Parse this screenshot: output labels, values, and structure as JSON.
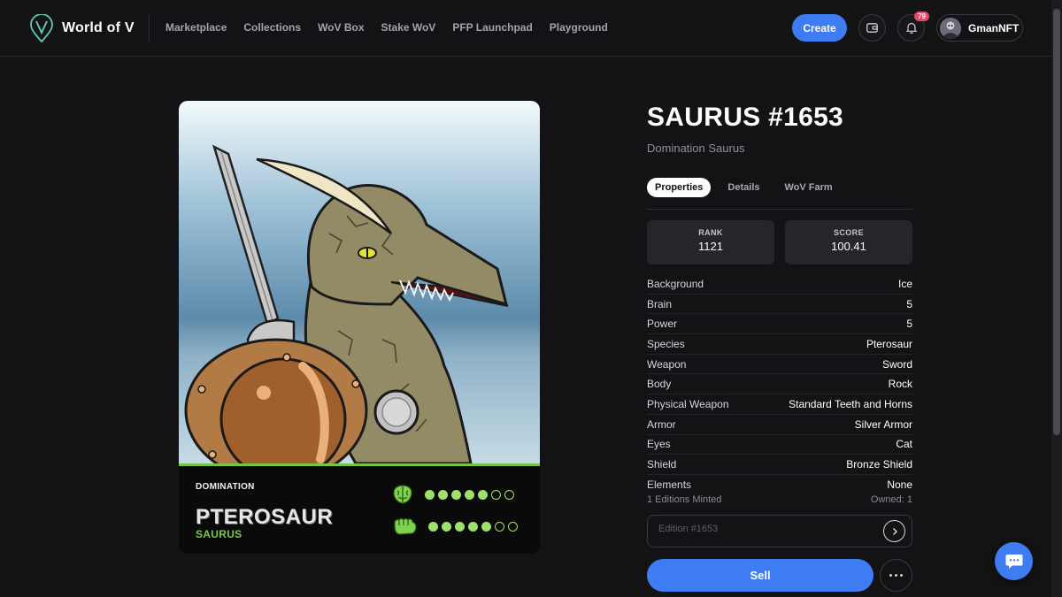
{
  "brand": {
    "name": "World of V"
  },
  "nav": {
    "items": [
      "Marketplace",
      "Collections",
      "WoV Box",
      "Stake WoV",
      "PFP Launchpad",
      "Playground"
    ]
  },
  "header": {
    "create_label": "Create",
    "notification_count": "79",
    "username": "GmanNFT"
  },
  "card": {
    "brand": "DOMINATION",
    "species": "PTEROSAUR",
    "type": "SAURUS",
    "brain_level": 5,
    "power_level": 5,
    "max_level": 7
  },
  "detail": {
    "title": "SAURUS #1653",
    "subtitle": "Domination Saurus",
    "tabs": [
      "Properties",
      "Details",
      "WoV Farm"
    ],
    "active_tab": "Properties",
    "rank_label": "RANK",
    "rank_value": "1121",
    "score_label": "SCORE",
    "score_value": "100.41",
    "properties": [
      {
        "key": "Background",
        "value": "Ice"
      },
      {
        "key": "Brain",
        "value": "5"
      },
      {
        "key": "Power",
        "value": "5"
      },
      {
        "key": "Species",
        "value": "Pterosaur"
      },
      {
        "key": "Weapon",
        "value": "Sword"
      },
      {
        "key": "Body",
        "value": "Rock"
      },
      {
        "key": "Physical Weapon",
        "value": "Standard Teeth and Horns"
      },
      {
        "key": "Armor",
        "value": "Silver Armor"
      },
      {
        "key": "Eyes",
        "value": "Cat"
      },
      {
        "key": "Shield",
        "value": "Bronze Shield"
      },
      {
        "key": "Elements",
        "value": "None"
      }
    ],
    "editions_minted": "1 Editions Minted",
    "owned": "Owned: 1",
    "edition_placeholder": "Edition #1653",
    "sell_label": "Sell"
  },
  "colors": {
    "accent": "#3d7cf2",
    "card_green": "#74c542",
    "badge": "#f0426a"
  }
}
